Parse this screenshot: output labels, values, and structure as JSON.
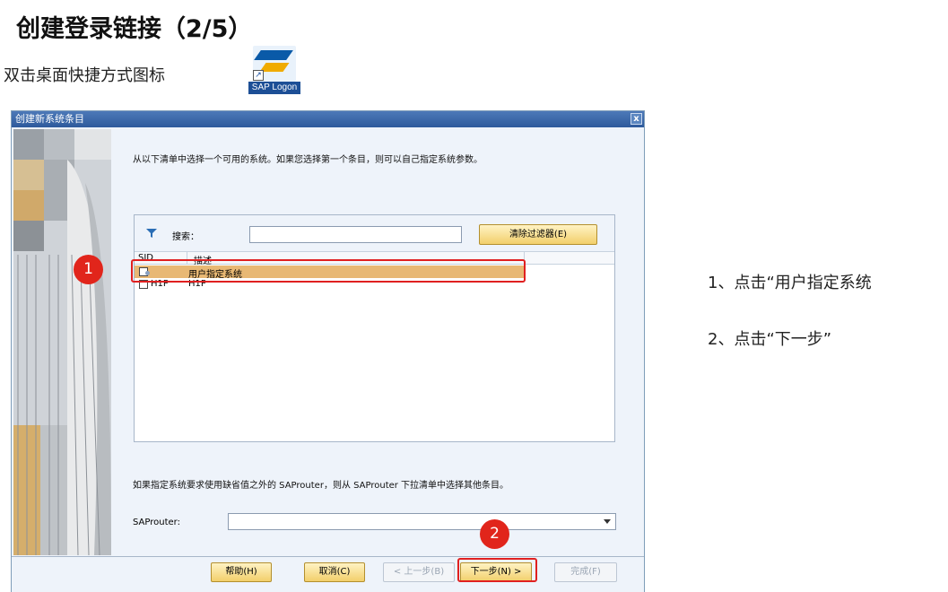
{
  "slide": {
    "title": "创建登录链接（2/5）",
    "instruction": "双击桌面快捷方式图标",
    "sap_logo_caption": "SAP Logon"
  },
  "dialog": {
    "title": "创建新系统条目",
    "close_label": "x",
    "lead_text": "从以下清单中选择一个可用的系统。如果您选择第一个条目，则可以自己指定系统参数。",
    "search_label": "搜索：",
    "search_value": "",
    "clear_filter_label": "清除过滤器(E)",
    "columns": {
      "sid": "SID",
      "desc": "描述"
    },
    "rows": [
      {
        "sid": "",
        "desc": "用户指定系统",
        "selected": true
      },
      {
        "sid": "H1P",
        "desc": "H1P",
        "selected": false
      }
    ],
    "router_text": "如果指定系统要求使用缺省值之外的 SAProuter，则从 SAProuter 下拉清单中选择其他条目。",
    "router_label": "SAProuter:",
    "router_value": "",
    "buttons": {
      "help": "帮助(H)",
      "cancel": "取消(C)",
      "back": "< 上一步(B)",
      "next": "下一步(N) >",
      "finish": "完成(F)"
    }
  },
  "annotations": {
    "badge_1": "1",
    "badge_2": "2",
    "note_1": "1、点击“用户指定系统",
    "note_2": "2、点击“下一步”",
    "highlight_color": "#e02020",
    "accent_color": "#f2cf6b"
  }
}
